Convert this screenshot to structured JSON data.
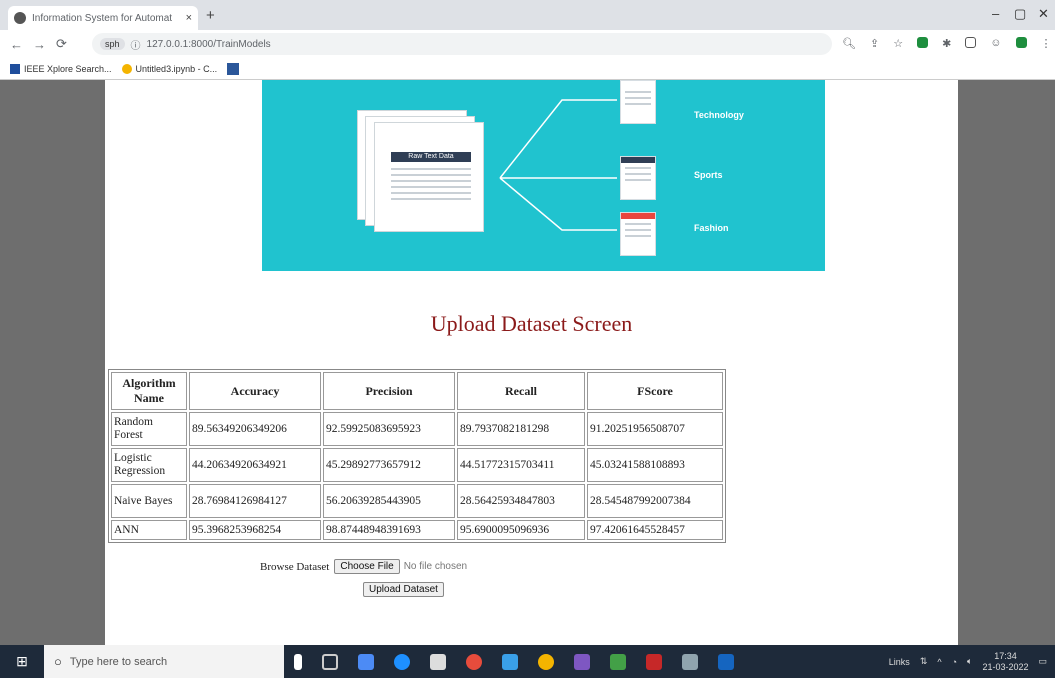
{
  "browser": {
    "tab_title": "Information System for Automat",
    "tab_close": "×",
    "new_tab": "+",
    "url": "127.0.0.1:8000/TrainModels",
    "profile_badge": "sph",
    "win_min": "–",
    "win_restore": "▢",
    "win_close": "✕",
    "bookmarks": [
      {
        "label": "IEEE Xplore Search..."
      },
      {
        "label": "Untitled3.ipynb - C..."
      }
    ]
  },
  "banner": {
    "doc_label": "Raw Text Data",
    "categories": [
      "Technology",
      "Sports",
      "Fashion"
    ]
  },
  "page": {
    "heading": "Upload Dataset Screen",
    "table": {
      "headers": [
        "Algorithm Name",
        "Accuracy",
        "Precision",
        "Recall",
        "FScore"
      ],
      "rows": [
        [
          "Random Forest",
          "89.56349206349206",
          "92.59925083695923",
          "89.7937082181298",
          "91.20251956508707"
        ],
        [
          "Logistic Regression",
          "44.20634920634921",
          "45.29892773657912",
          "44.51772315703411",
          "45.03241588108893"
        ],
        [
          "Naive Bayes",
          "28.76984126984127",
          "56.20639285443905",
          "28.56425934847803",
          "28.545487992007384"
        ],
        [
          "ANN",
          "95.3968253968254",
          "98.87448948391693",
          "95.6900095096936",
          "97.42061645528457"
        ]
      ]
    },
    "browse_label": "Browse Dataset",
    "choose_file": "Choose File",
    "no_file": "No file chosen",
    "upload_button": "Upload Dataset"
  },
  "taskbar": {
    "search_placeholder": "Type here to search",
    "tray_links": "Links",
    "time": "17:34",
    "date": "21-03-2022"
  },
  "colors": {
    "banner": "#20c3cf",
    "heading": "#8b1a1a",
    "taskbar": "#1e2a3a"
  }
}
